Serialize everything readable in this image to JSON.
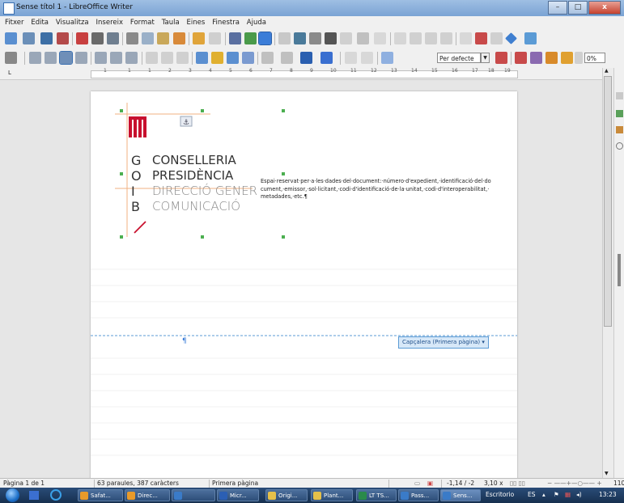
{
  "window": {
    "title": "Sense títol 1 - LibreOffice Writer",
    "minimize": "–",
    "maximize": "□",
    "close": "x"
  },
  "menu": [
    "Fitxer",
    "Edita",
    "Visualitza",
    "Insereix",
    "Format",
    "Taula",
    "Eines",
    "Finestra",
    "Ajuda"
  ],
  "toolbar2": {
    "paragraph_style": "Per defecte",
    "zoom": "0%"
  },
  "ruler": {
    "numbers": [
      "1",
      "1",
      "1",
      "2",
      "3",
      "4",
      "5",
      "6",
      "7",
      "8",
      "9",
      "10",
      "11",
      "12",
      "13",
      "14",
      "15",
      "16",
      "17",
      "18",
      "19"
    ]
  },
  "logo": {
    "letters": [
      "G",
      "O",
      "I",
      "B"
    ],
    "lines": [
      "CONSELLERIA",
      "PRESIDÈNCIA",
      "DIRECCIÓ GENER",
      "COMUNICACIÓ"
    ]
  },
  "document": {
    "reserved_text": "Espai·reservat·per·a·les·dades·del·document:·número·d'expedient,·identificació·del·document,·emissor,·sol·licitant,·codi·d'identificació·de·la·unitat,·codi·d'interoperabilitat,·metadades,·etc.¶",
    "pilcrow": "¶",
    "header_label": "Capçalera (Primera pàgina)"
  },
  "status": {
    "page": "Pàgina 1 de 1",
    "words": "63 paraules, 387 caràcters",
    "page_style": "Primera pàgina",
    "position": "-1,14 / -2",
    "size": "3,10 x",
    "zoom": "110"
  },
  "taskbar": {
    "items": [
      {
        "label": "Safat...",
        "color": "#e89a2a"
      },
      {
        "label": "Direc...",
        "color": "#e89a2a"
      },
      {
        "label": "",
        "color": "#3a7bc8"
      },
      {
        "label": "Micr...",
        "color": "#2b5fb4"
      },
      {
        "label": "Origi...",
        "color": "#e5c04a"
      },
      {
        "label": "Plant...",
        "color": "#e5c04a"
      },
      {
        "label": "LT TS...",
        "color": "#2a8a4a"
      },
      {
        "label": "Pass...",
        "color": "#3a7bc8"
      },
      {
        "label": "Sens...",
        "color": "#3a7bc8"
      }
    ],
    "escriptori": "Escritorio",
    "lang": "ES",
    "time": "13:23"
  },
  "colors": {
    "accent": "#5b9bd5",
    "logo_red": "#c8102e",
    "logo_gray": "#555555",
    "guide_orange": "#f0b080",
    "handle_green": "#4caf50"
  }
}
